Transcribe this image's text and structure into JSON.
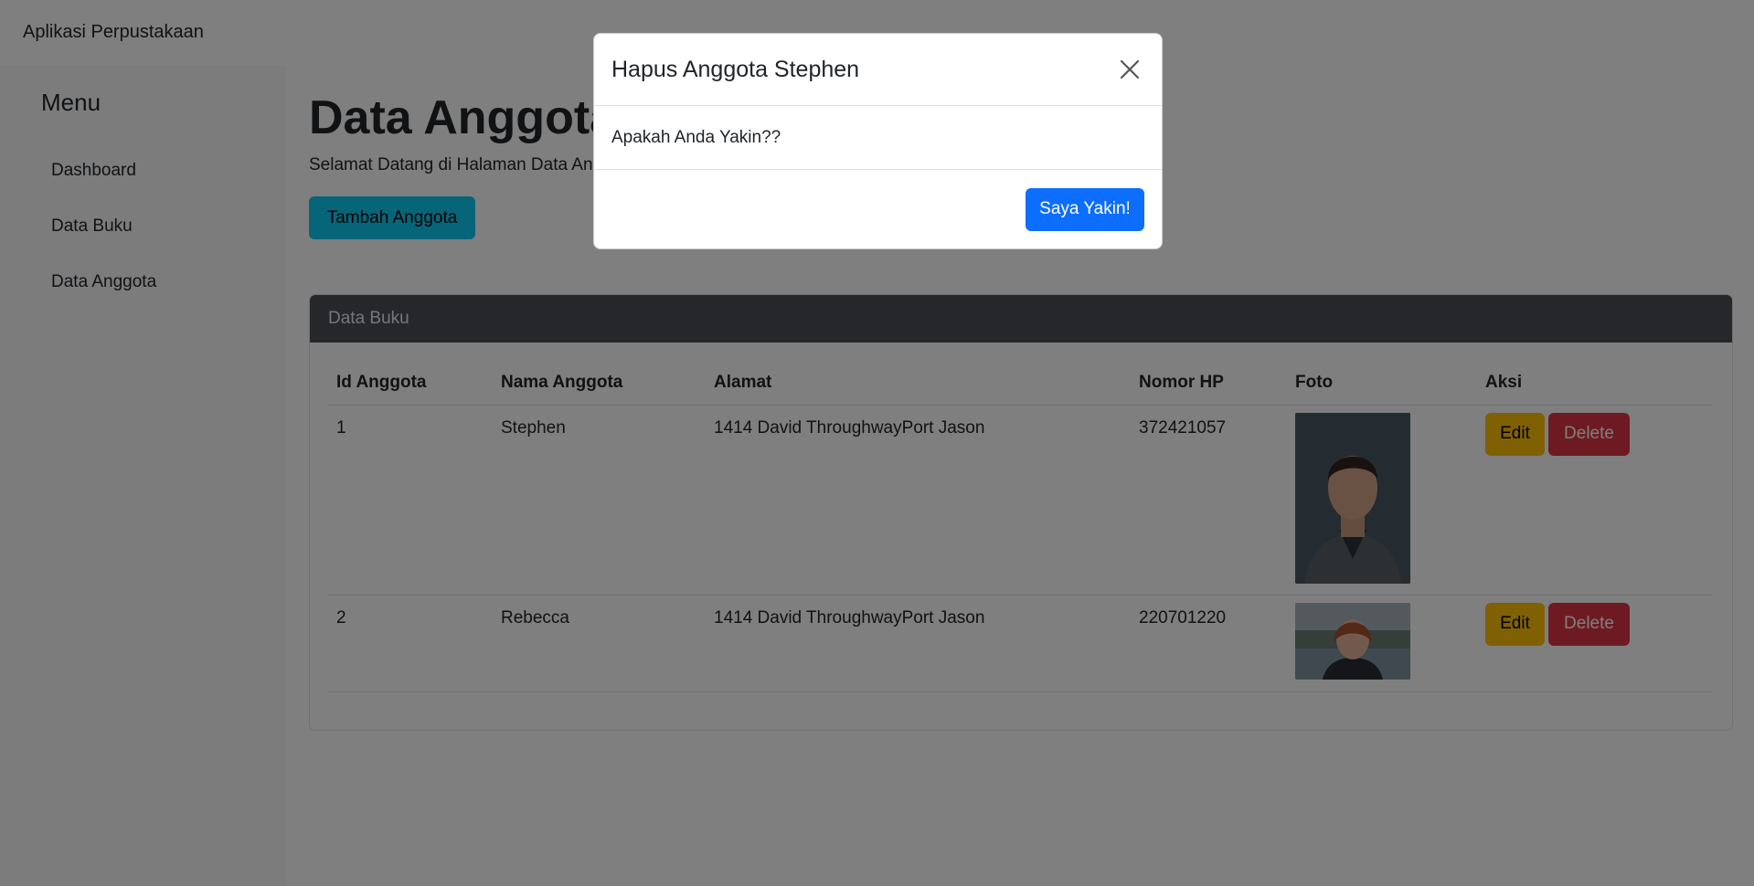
{
  "navbar": {
    "brand": "Aplikasi Perpustakaan"
  },
  "sidebar": {
    "title": "Menu",
    "items": [
      {
        "label": "Dashboard"
      },
      {
        "label": "Data Buku"
      },
      {
        "label": "Data Anggota"
      }
    ]
  },
  "main": {
    "title": "Data Anggota",
    "subtitle": "Selamat Datang di Halaman Data Anggota",
    "add_button": "Tambah Anggota",
    "card": {
      "header": "Data Buku",
      "columns": [
        "Id Anggota",
        "Nama Anggota",
        "Alamat",
        "Nomor HP",
        "Foto",
        "Aksi"
      ],
      "rows": [
        {
          "id": "1",
          "name": "Stephen",
          "address": "1414 David ThroughwayPort Jason",
          "phone": "372421057",
          "photo": "portrait-man"
        },
        {
          "id": "2",
          "name": "Rebecca",
          "address": "1414 David ThroughwayPort Jason",
          "phone": "220701220",
          "photo": "portrait-woman"
        }
      ],
      "edit_label": "Edit",
      "delete_label": "Delete"
    }
  },
  "modal": {
    "title": "Hapus Anggota Stephen",
    "body": "Apakah Anda Yakin??",
    "confirm_label": "Saya Yakin!",
    "close_icon": "close-icon"
  },
  "colors": {
    "primary": "#0d6efd",
    "info": "#0dcaf0",
    "warning": "#ffc107",
    "danger": "#dc3545",
    "card_header": "#4a4f55"
  }
}
